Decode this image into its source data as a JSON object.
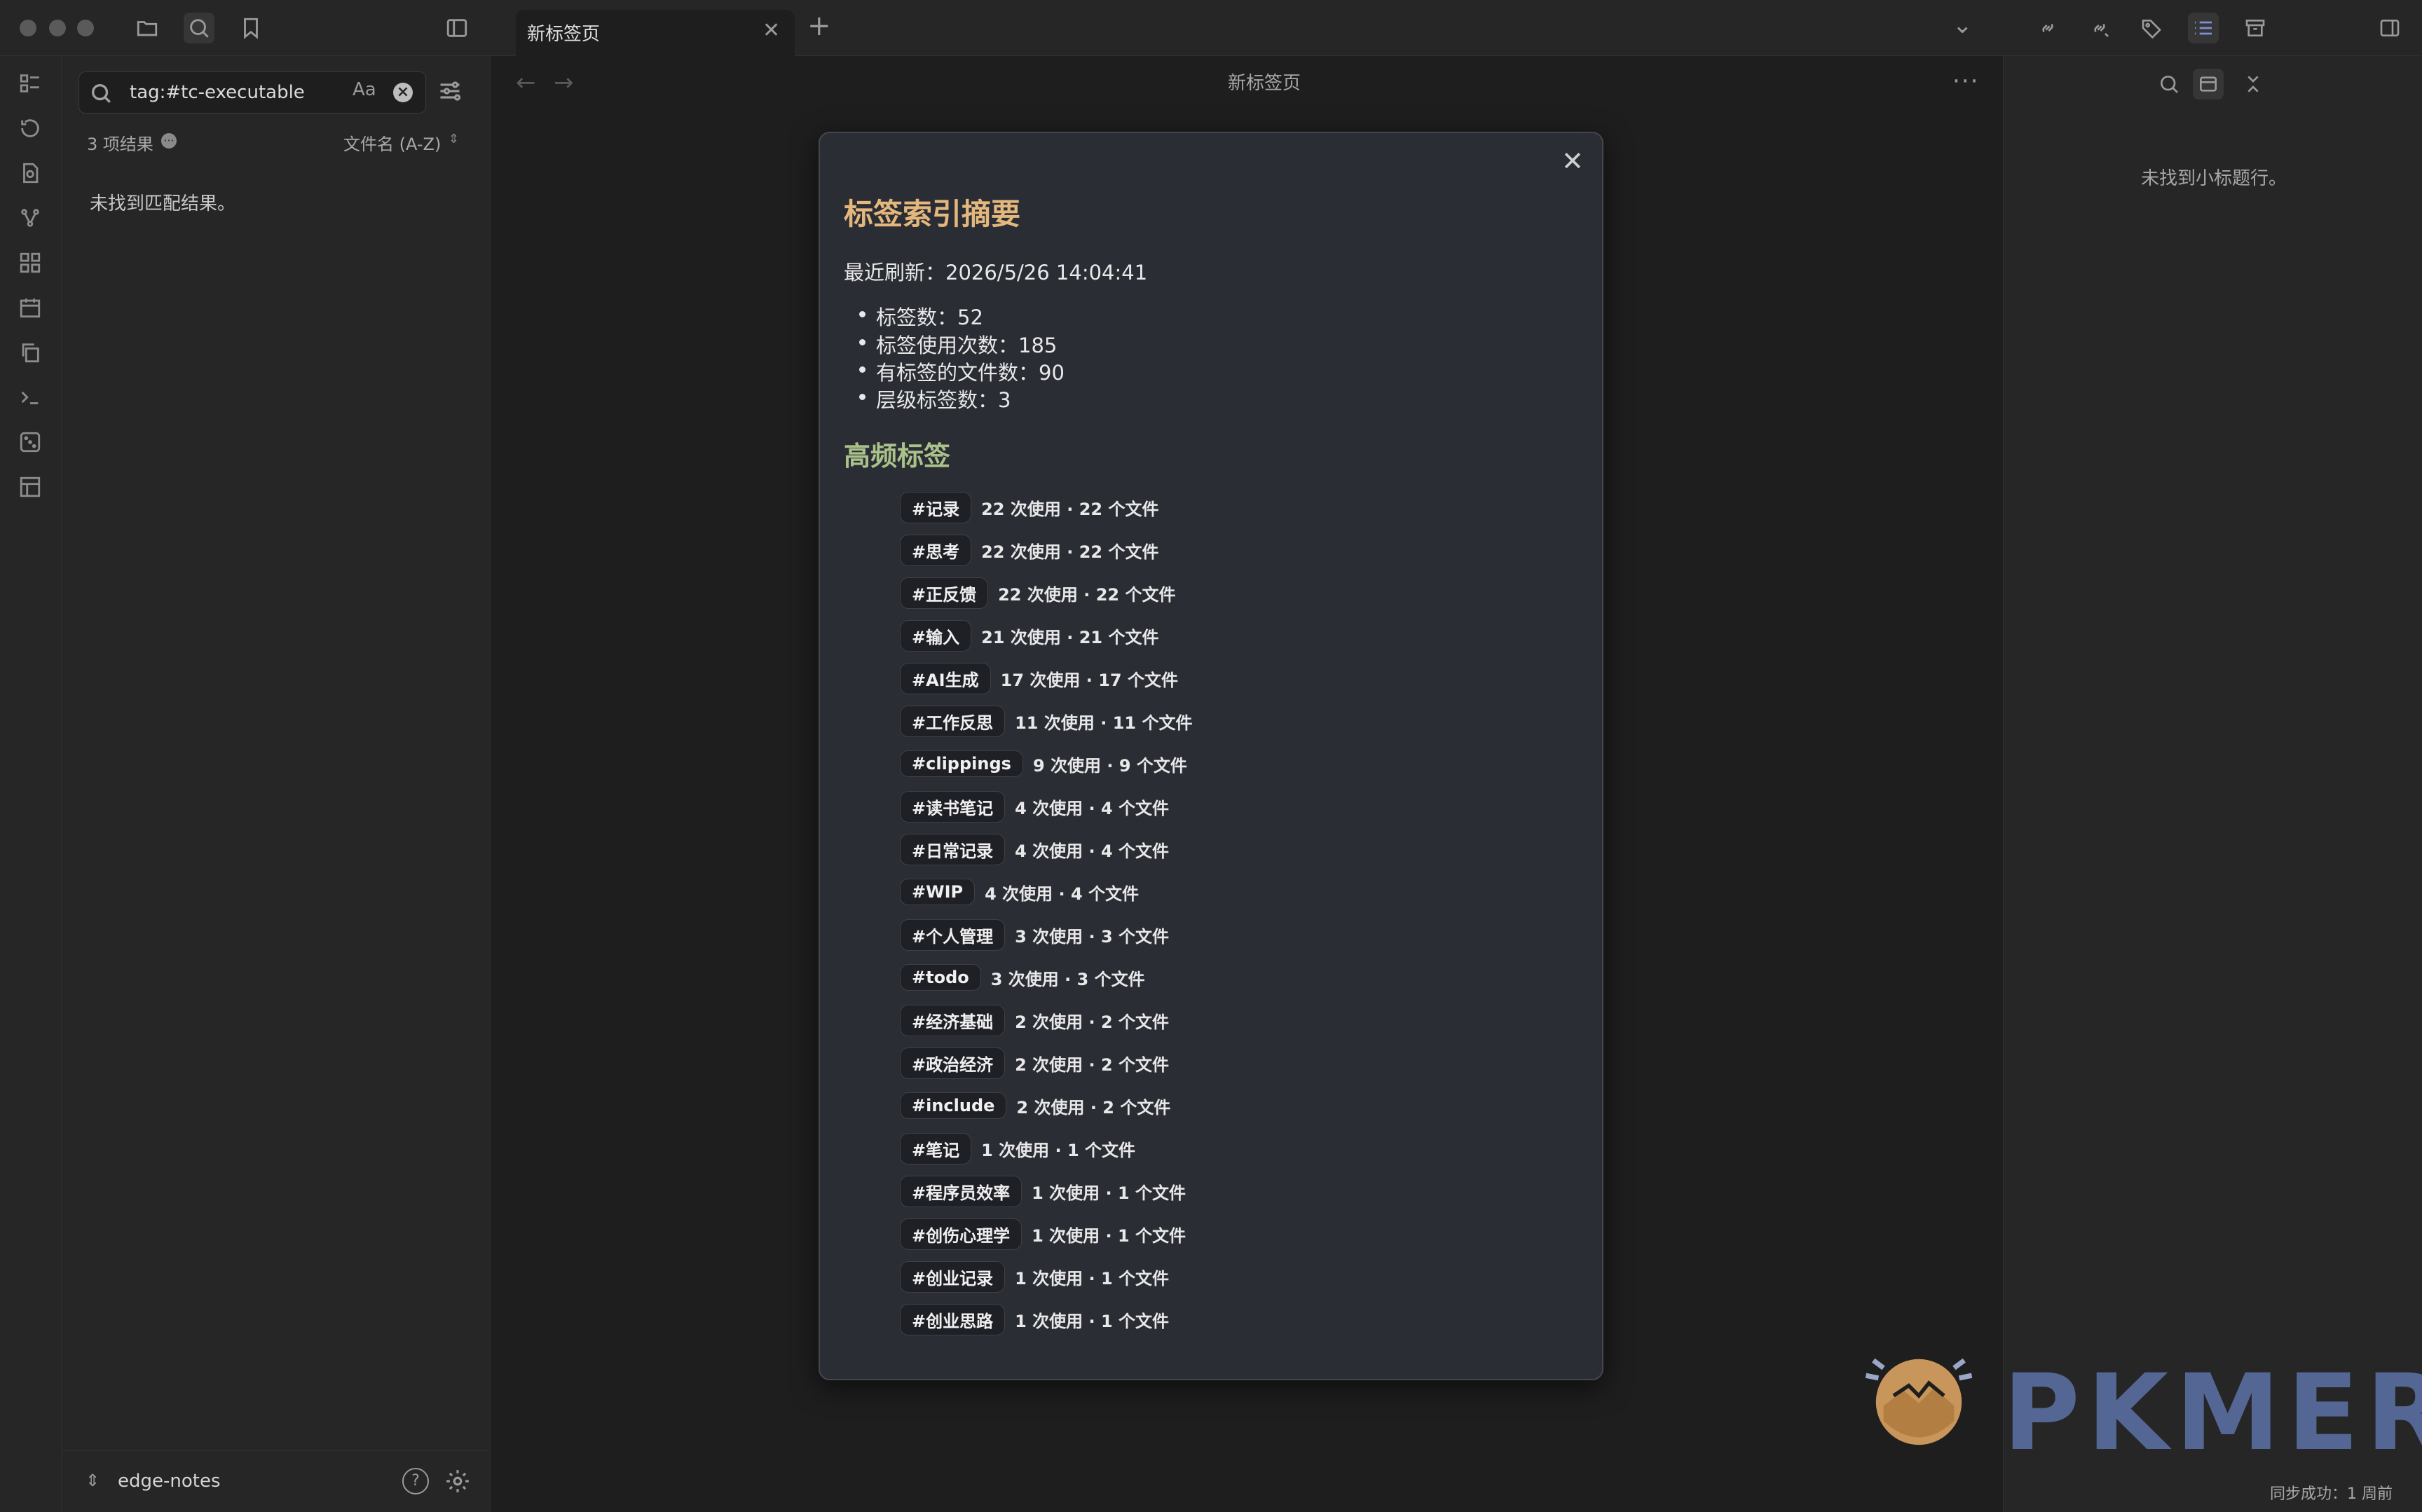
{
  "tabs": [
    {
      "title": "新标签页"
    }
  ],
  "main": {
    "view_title": "新标签页"
  },
  "search": {
    "query": "tag:#tc-executable",
    "case_label": "Aa",
    "results_count": "3 项结果",
    "sort_label": "文件名 (A-Z)",
    "no_match": "未找到匹配结果。"
  },
  "vault": {
    "name": "edge-notes"
  },
  "right_panel": {
    "no_headings": "未找到小标题行。",
    "sync_status": "同步成功：1 周前"
  },
  "modal": {
    "title": "标签索引摘要",
    "refresh": "最近刷新：2026/5/26 14:04:41",
    "stats": [
      "标签数：52",
      "标签使用次数：185",
      "有标签的文件数：90",
      "层级标签数：3"
    ],
    "freq_title": "高频标签",
    "tags": [
      {
        "name": "#记录",
        "meta": "22 次使用 · 22 个文件"
      },
      {
        "name": "#思考",
        "meta": "22 次使用 · 22 个文件"
      },
      {
        "name": "#正反馈",
        "meta": "22 次使用 · 22 个文件"
      },
      {
        "name": "#输入",
        "meta": "21 次使用 · 21 个文件"
      },
      {
        "name": "#AI生成",
        "meta": "17 次使用 · 17 个文件"
      },
      {
        "name": "#工作反思",
        "meta": "11 次使用 · 11 个文件"
      },
      {
        "name": "#clippings",
        "meta": "9 次使用 · 9 个文件"
      },
      {
        "name": "#读书笔记",
        "meta": "4 次使用 · 4 个文件"
      },
      {
        "name": "#日常记录",
        "meta": "4 次使用 · 4 个文件"
      },
      {
        "name": "#WIP",
        "meta": "4 次使用 · 4 个文件"
      },
      {
        "name": "#个人管理",
        "meta": "3 次使用 · 3 个文件"
      },
      {
        "name": "#todo",
        "meta": "3 次使用 · 3 个文件"
      },
      {
        "name": "#经济基础",
        "meta": "2 次使用 · 2 个文件"
      },
      {
        "name": "#政治经济",
        "meta": "2 次使用 · 2 个文件"
      },
      {
        "name": "#include",
        "meta": "2 次使用 · 2 个文件"
      },
      {
        "name": "#笔记",
        "meta": "1 次使用 · 1 个文件"
      },
      {
        "name": "#程序员效率",
        "meta": "1 次使用 · 1 个文件"
      },
      {
        "name": "#创伤心理学",
        "meta": "1 次使用 · 1 个文件"
      },
      {
        "name": "#创业记录",
        "meta": "1 次使用 · 1 个文件"
      },
      {
        "name": "#创业思路",
        "meta": "1 次使用 · 1 个文件"
      }
    ]
  },
  "watermark": {
    "text": "PKMER"
  },
  "colors": {
    "title": "#e4b77d",
    "subtitle": "#a9c28a",
    "background": "#1e1e1e",
    "panel": "#262626",
    "modal": "#2b2d35",
    "watermark": "#5a6ea0"
  }
}
